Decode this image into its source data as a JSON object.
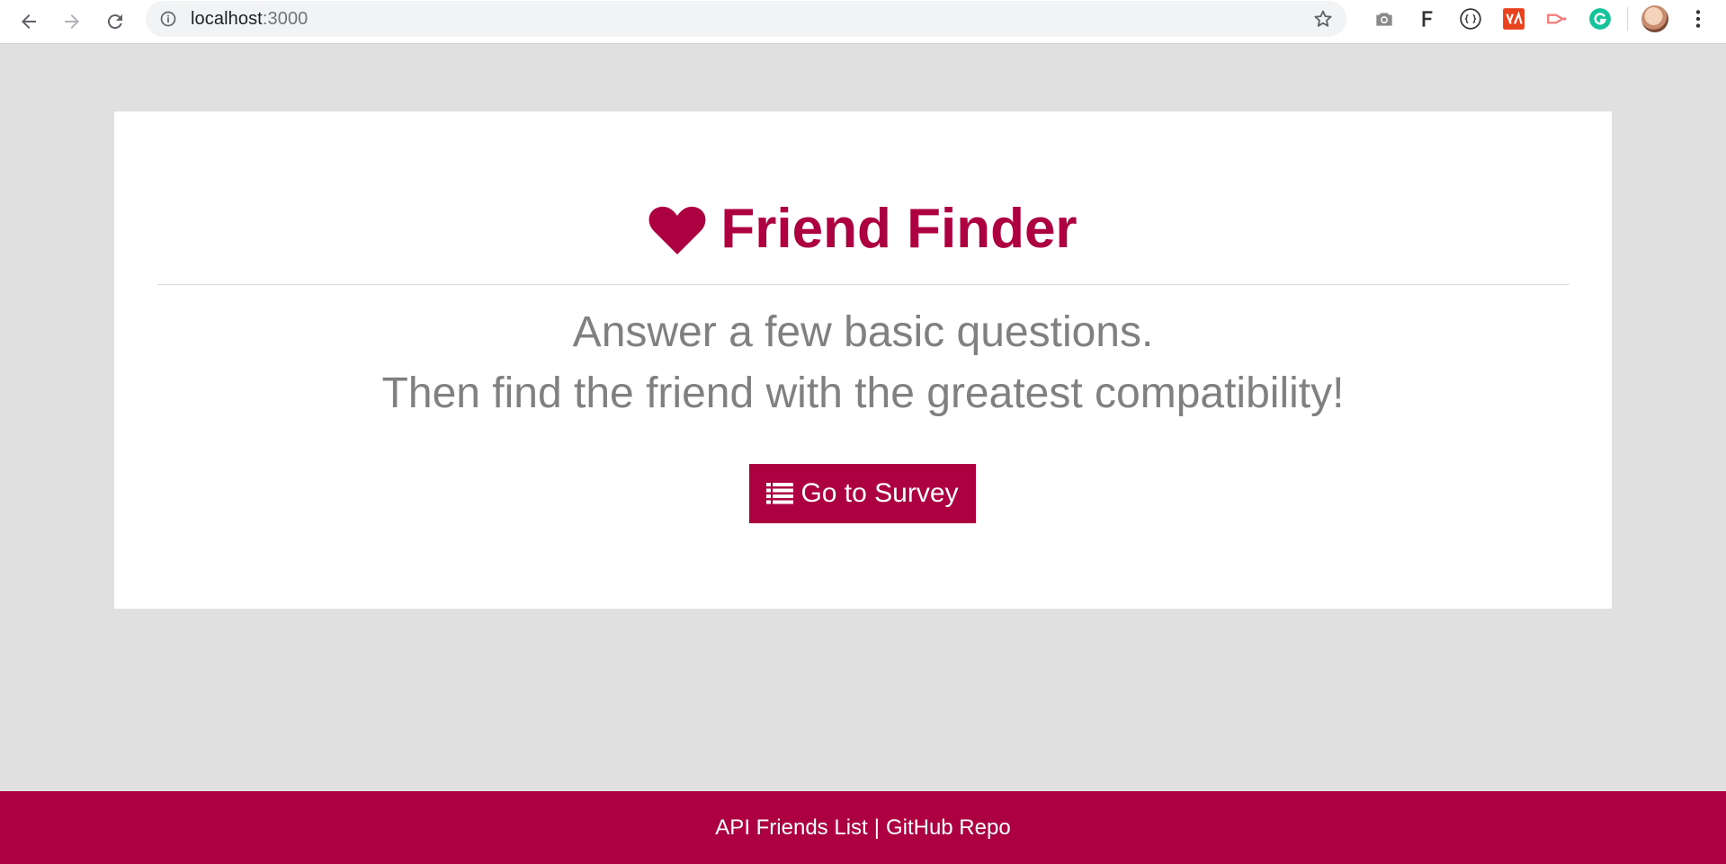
{
  "browser": {
    "url_host": "localhost",
    "url_port": ":3000",
    "extensions": [
      "camera-icon",
      "f-icon",
      "json-viewer-icon",
      "ublock-icon",
      "cast-icon",
      "grammarly-icon"
    ]
  },
  "page": {
    "title": "Friend Finder",
    "subtitle_line1": "Answer a few basic questions.",
    "subtitle_line2": "Then find the friend with the greatest compatibility!",
    "survey_button": "Go to Survey"
  },
  "footer": {
    "api_link": "API Friends List",
    "separator": "|",
    "github_link": "GitHub Repo"
  },
  "colors": {
    "brand": "#ad0040",
    "background": "#e0e0e0",
    "muted_text": "#808080"
  }
}
